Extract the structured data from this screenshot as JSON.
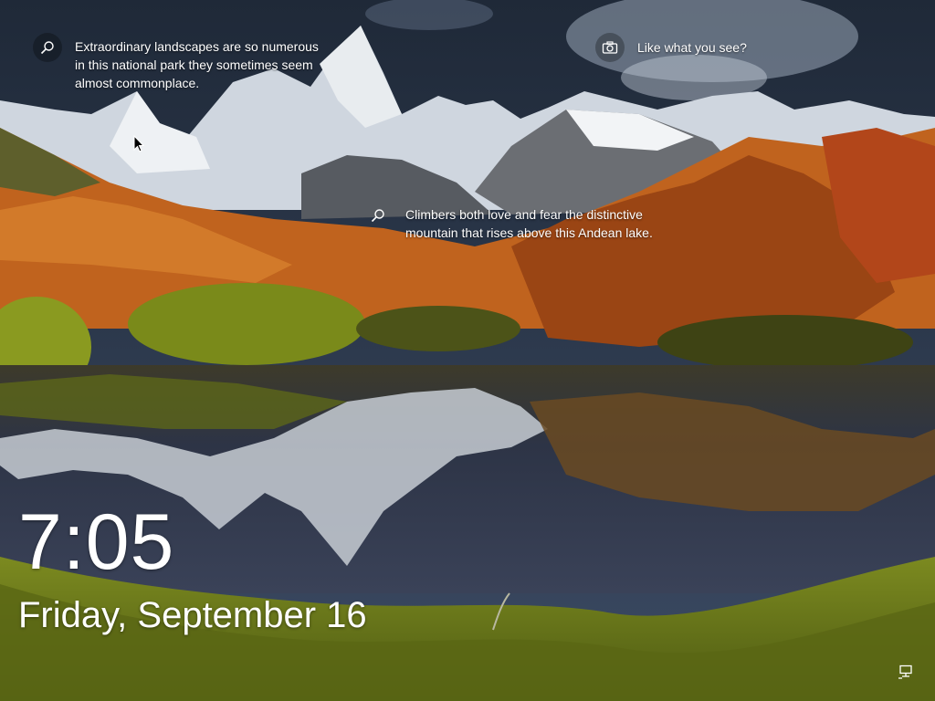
{
  "lockscreen": {
    "hotspots": [
      {
        "icon": "search-icon",
        "text": "Extraordinary landscapes are so numerous in this national park they sometimes seem almost commonplace."
      },
      {
        "icon": "camera-icon",
        "text": "Like what you see?"
      },
      {
        "icon": "search-icon",
        "text": "Climbers both love and fear the distinctive mountain that rises above this Andean lake."
      }
    ],
    "time": "7:05",
    "date": "Friday, September 16",
    "network_icon": "network-icon"
  },
  "colors": {
    "sky": "#2d3a4e",
    "snow": "#e8ecef",
    "foliage_orange": "#c0631e",
    "moss_green": "#7a8a1a",
    "lake": "#2a3140"
  }
}
